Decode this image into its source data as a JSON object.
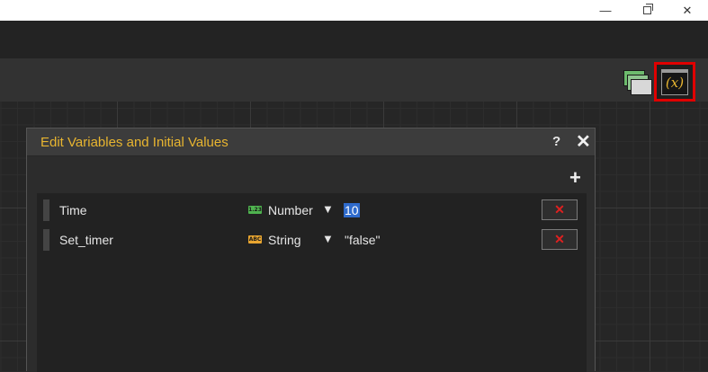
{
  "window": {
    "minimize_glyph": "—",
    "close_glyph": "✕"
  },
  "toolbar": {
    "variables_button_label": "(x)"
  },
  "dialog": {
    "title": "Edit Variables and Initial Values",
    "help_label": "?",
    "close_label": "✕",
    "add_label": "+",
    "variables": [
      {
        "name": "Time",
        "type_icon_text": "1.23",
        "type": "Number",
        "dropdown_glyph": "▼",
        "value": "10",
        "delete_label": "✕"
      },
      {
        "name": "Set_timer",
        "type_icon_text": "ABC",
        "type": "String",
        "dropdown_glyph": "▼",
        "value": "\"false\"",
        "delete_label": "✕"
      }
    ]
  },
  "colors": {
    "accent_title": "#e8b530",
    "highlight_border": "#e00000",
    "delete_x": "#e02020",
    "number_type": "#4fb34f",
    "string_type": "#e8a530",
    "selection": "#2f6bcc"
  },
  "icons": {
    "layers": "layers-icon",
    "variables": "variables-icon",
    "number_type": "number-type-icon",
    "string_type": "string-type-icon"
  }
}
